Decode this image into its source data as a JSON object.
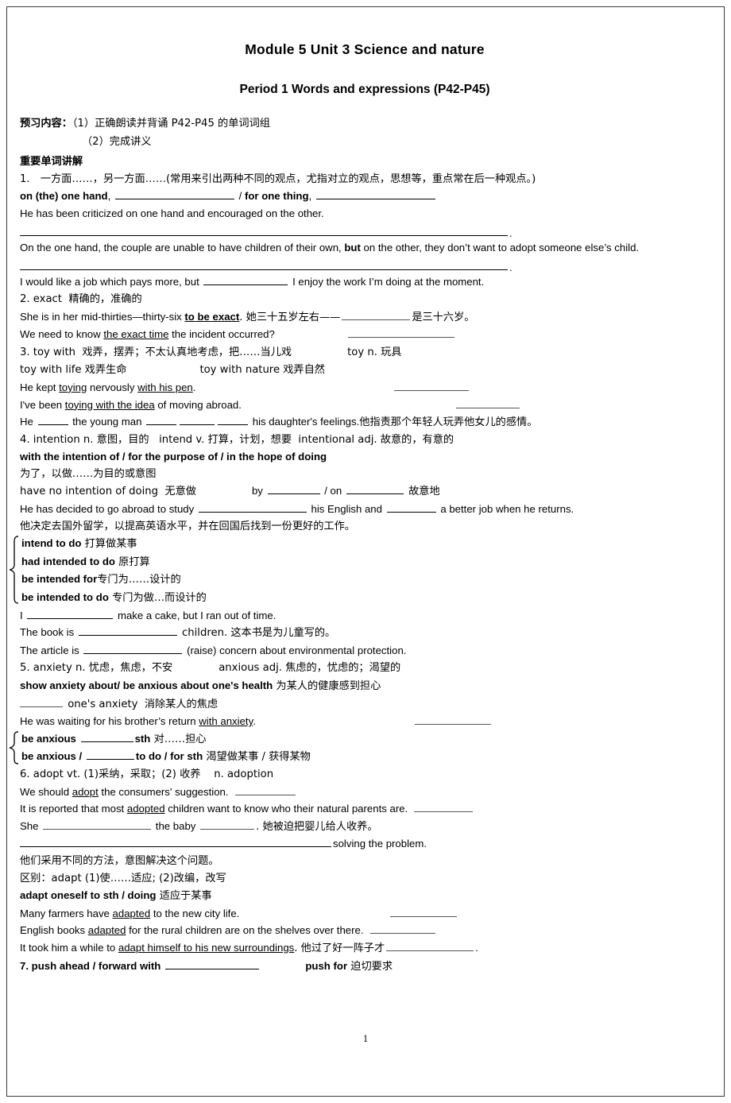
{
  "document": {
    "title_main": "Module 5    Unit 3   Science and nature",
    "title_sub": "Period 1 Words and expressions (P42-P45)",
    "page_number": "1",
    "preview": {
      "label": "预习内容：",
      "item1": "（1）正确朗读并背诵 P42-P45 的单词词组",
      "item2": "（2）完成讲义"
    },
    "section_heading": "重要单词讲解",
    "entries": {
      "e1": {
        "num_line": "1.　一方面……，另一方面……(常用来引出两种不同的观点，尤指对立的观点，思想等，重点常在后一种观点。)",
        "phrase_a": "on (the) one hand",
        "sep_comma": ", ",
        "slash": " / ",
        "phrase_b": "for one thing",
        "ex1": "He has been criticized on one hand and encouraged on the other.",
        "ex2_pre": "On the one hand, the couple are unable to have children of their own, ",
        "ex2_bold": "but",
        "ex2_post": " on the other, they don’t want to adopt someone else’s child.",
        "ex3_pre": "I would like a job which pays more, but ",
        "ex3_post": " I enjoy the work I’m doing at the moment."
      },
      "e2": {
        "head": "2. exact  精确的，准确的",
        "ex1_pre": "She is in her mid-thirties—thirty-six ",
        "ex1_bold": "to be exact",
        "ex1_mid": ". 她三十五岁左右——",
        "ex1_post": "是三十六岁。",
        "ex2_pre": "We need to know ",
        "ex2_u": "the exact time",
        "ex2_post": " the incident occurred?"
      },
      "e3": {
        "head_a": "3. toy with  戏弄，摆弄；不太认真地考虑，把……当儿戏",
        "head_b": "toy n. 玩具",
        "line2_a": "toy with life 戏弄生命",
        "line2_b": "toy with nature 戏弄自然",
        "ex1_pre": "He kept ",
        "ex1_u1": "toying",
        "ex1_mid": " nervously ",
        "ex1_u2": "with his pen",
        "ex1_post": ".",
        "ex2_pre": "I've been ",
        "ex2_u": "toying with the idea",
        "ex2_post": " of moving abroad.",
        "ex3_a": "He ",
        "ex3_b": " the young man ",
        "ex3_c": " his daughter's feelings.",
        "ex3_cn": "他指责那个年轻人玩弄他女儿的感情。"
      },
      "e4": {
        "head": "4. intention n. 意图，目的   intend v. 打算，计划，想要  intentional adj. 故意的，有意的",
        "phrases_bold": "with the intention of / for the purpose of / in the hope of doing",
        "phrases_cn": "为了，以做……为目的或意图",
        "line_a": "have no intention of doing  无意做",
        "line_b": "by ",
        "line_c": " / on ",
        "line_d": " 故意地",
        "ex1_a": "He has decided to go abroad to study ",
        "ex1_b": " his English and ",
        "ex1_c": " a better job when he returns.",
        "ex1_cn": "他决定去国外留学，以提高英语水平，并在回国后找到一份更好的工作。",
        "brace_items": [
          {
            "bold": "intend to do",
            "cn": " 打算做某事"
          },
          {
            "bold": "had intended to do",
            "cn": " 原打算"
          },
          {
            "bold": "be intended for",
            "cn": "专门为……设计的"
          },
          {
            "bold": "be intended to do",
            "cn": " 专门为做…而设计的"
          }
        ],
        "ex2_a": "I ",
        "ex2_b": " make a cake, but I ran out of time.",
        "ex3_a": "The book is ",
        "ex3_b": " children. 这本书是为儿童写的。",
        "ex4_a": "The article is ",
        "ex4_b": " (raise) concern about environmental protection."
      },
      "e5": {
        "head_a": "5. anxiety n. 忧虑，焦虑，不安",
        "head_b": "anxious adj. 焦虑的，忧虑的；渴望的",
        "phrase_bold": "show anxiety about/ be anxious about one's health",
        "phrase_cn": " 为某人的健康感到担心",
        "line_a": " one's anxiety  消除某人的焦虑",
        "ex1_pre": "He was waiting for his brother’s return ",
        "ex1_u": "with anxiety",
        "ex1_post": ".",
        "brace_items": [
          {
            "pre": "be anxious ",
            "post": "sth",
            "cn": " 对……担心"
          },
          {
            "pre": "be anxious / ",
            "post": "to do / for sth",
            "cn": " 渴望做某事 / 获得某物"
          }
        ]
      },
      "e6": {
        "head": "6. adopt vt. (1)采纳，采取；(2) 收养    n. adoption",
        "ex1_pre": "We should ",
        "ex1_u": "adopt",
        "ex1_post": " the consumers' suggestion.",
        "ex2_pre": "It is reported that most ",
        "ex2_u": "adopted",
        "ex2_post": " children want to know who their natural parents are.",
        "ex3_a": "She ",
        "ex3_b": " the baby ",
        "ex3_c": ". 她被迫把婴儿给人收养。",
        "ex4_post": "solving the problem.",
        "ex4_cn": "他们采用不同的方法，意图解决这个问题。",
        "distinction": "区别：adapt (1)使……适应; (2)改编，改写",
        "phrase_bold": "adapt oneself to sth / doing",
        "phrase_cn": " 适应于某事",
        "ex5_pre": "Many farmers have ",
        "ex5_u": "adapted",
        "ex5_post": " to the new city life.",
        "ex6_pre": "English books ",
        "ex6_u": "adapted",
        "ex6_post": " for the rural children are on the shelves over there.",
        "ex7_pre": "It took him a while to ",
        "ex7_u": "adapt himself to his new surroundings",
        "ex7_mid": ". 他过了好一阵子才",
        "ex7_post": "."
      },
      "e7": {
        "num_bold": "7. push ahead / forward with",
        "phrase_bold": "push for",
        "phrase_cn": " 迫切要求"
      }
    }
  }
}
